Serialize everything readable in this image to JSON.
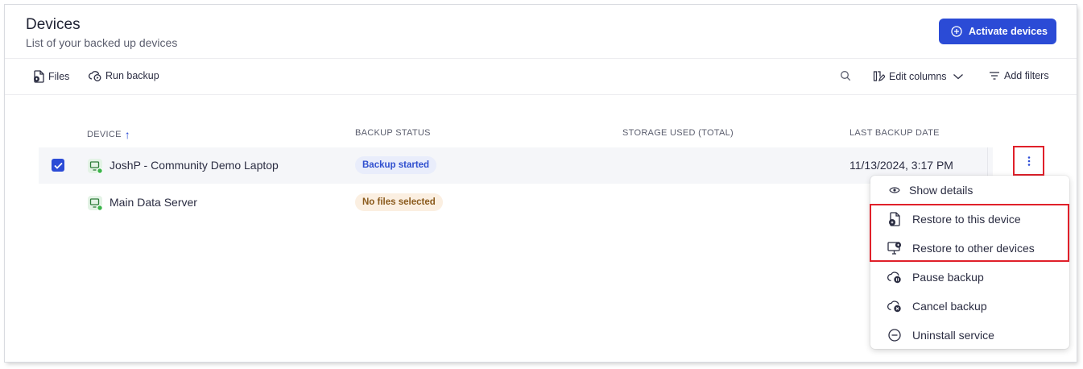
{
  "header": {
    "title": "Devices",
    "subtitle": "List of your backed up devices",
    "activate_label": "Activate devices"
  },
  "toolbar": {
    "files_label": "Files",
    "run_backup_label": "Run backup",
    "edit_columns_label": "Edit columns",
    "add_filters_label": "Add filters"
  },
  "table": {
    "columns": [
      "DEVICE",
      "BACKUP STATUS",
      "STORAGE USED (TOTAL)",
      "LAST BACKUP DATE"
    ],
    "sort_indicator": "↑",
    "rows": [
      {
        "device": "JoshP - Community Demo Laptop",
        "status": "Backup started",
        "storage": "",
        "last_backup": "11/13/2024, 3:17 PM",
        "selected": true
      },
      {
        "device": "Main Data Server",
        "status": "No files selected",
        "storage": "",
        "last_backup": "",
        "selected": false
      }
    ]
  },
  "context_menu": {
    "items": [
      {
        "label": "Show details",
        "icon": "eye-icon"
      },
      {
        "label": "Restore to this device",
        "icon": "restore-file-icon"
      },
      {
        "label": "Restore to other devices",
        "icon": "restore-monitor-icon"
      },
      {
        "label": "Pause backup",
        "icon": "cloud-pause-icon"
      },
      {
        "label": "Cancel backup",
        "icon": "cloud-cancel-icon"
      },
      {
        "label": "Uninstall service",
        "icon": "minus-circle-icon"
      }
    ]
  },
  "colors": {
    "primary": "#2b4bd6",
    "highlight": "#e0202a",
    "status_blue_bg": "#e9edfb",
    "status_orange_bg": "#fbefe1",
    "online_green": "#3bb54a"
  }
}
